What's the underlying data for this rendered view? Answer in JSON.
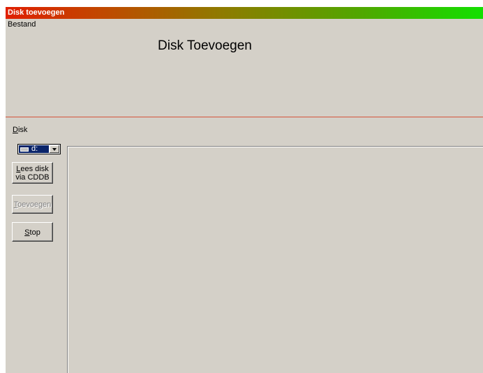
{
  "window": {
    "title": "Disk toevoegen"
  },
  "menu": {
    "items": [
      {
        "label": "Bestand"
      }
    ]
  },
  "header": {
    "title": "Disk Toevoegen"
  },
  "disk": {
    "label_mnemonic": "D",
    "label_rest": "isk",
    "selected_drive": "d:"
  },
  "buttons": {
    "lees": {
      "mnemonic": "L",
      "line1_rest": "ees disk",
      "line2": "via CDDB"
    },
    "toevoegen": {
      "mnemonic": "T",
      "rest": "oevoegen",
      "disabled": true
    },
    "stop": {
      "mnemonic": "S",
      "rest": "top"
    }
  },
  "colors": {
    "title_gradient_start": "#e01f00",
    "title_gradient_end": "#12e000",
    "divider": "#d4543b",
    "window_bg": "#d4d0c8",
    "selection": "#0a246a"
  }
}
